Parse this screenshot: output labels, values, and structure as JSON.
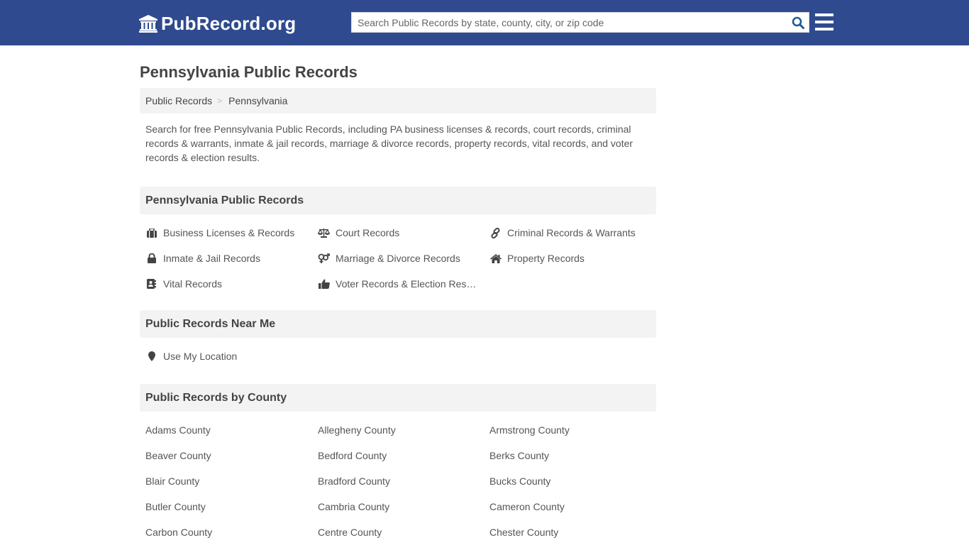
{
  "header": {
    "logo_text": "PubRecord.org",
    "logo_icon": "courthouse-icon",
    "search_placeholder": "Search Public Records by state, county, city, or zip code",
    "search_value": "",
    "search_icon": "search-icon",
    "menu_icon": "hamburger-menu-icon",
    "brand_color": "#2f4a8f",
    "search_icon_color": "#1d5b9f"
  },
  "page": {
    "title": "Pennsylvania Public Records",
    "breadcrumb": [
      {
        "label": "Public Records"
      },
      {
        "label": "Pennsylvania"
      }
    ],
    "breadcrumb_separator": ">",
    "description": "Search for free Pennsylvania Public Records, including PA business licenses & records, court records, criminal records & warrants, inmate & jail records, marriage & divorce records, property records, vital records, and voter records & election results."
  },
  "records_section": {
    "heading": "Pennsylvania Public Records",
    "items": [
      {
        "label": "Business Licenses & Records",
        "icon": "briefcase-icon"
      },
      {
        "label": "Court Records",
        "icon": "balance-scale-icon"
      },
      {
        "label": "Criminal Records & Warrants",
        "icon": "link-icon"
      },
      {
        "label": "Inmate & Jail Records",
        "icon": "lock-icon"
      },
      {
        "label": "Marriage & Divorce Records",
        "icon": "venus-mars-icon"
      },
      {
        "label": "Property Records",
        "icon": "home-icon"
      },
      {
        "label": "Vital Records",
        "icon": "address-book-icon"
      },
      {
        "label": "Voter Records & Election Results",
        "icon": "thumbs-up-icon"
      }
    ]
  },
  "near_section": {
    "heading": "Public Records Near Me",
    "items": [
      {
        "label": "Use My Location",
        "icon": "map-marker-icon"
      }
    ]
  },
  "county_section": {
    "heading": "Public Records by County",
    "counties": [
      "Adams County",
      "Allegheny County",
      "Armstrong County",
      "Beaver County",
      "Bedford County",
      "Berks County",
      "Blair County",
      "Bradford County",
      "Bucks County",
      "Butler County",
      "Cambria County",
      "Cameron County",
      "Carbon County",
      "Centre County",
      "Chester County"
    ]
  }
}
